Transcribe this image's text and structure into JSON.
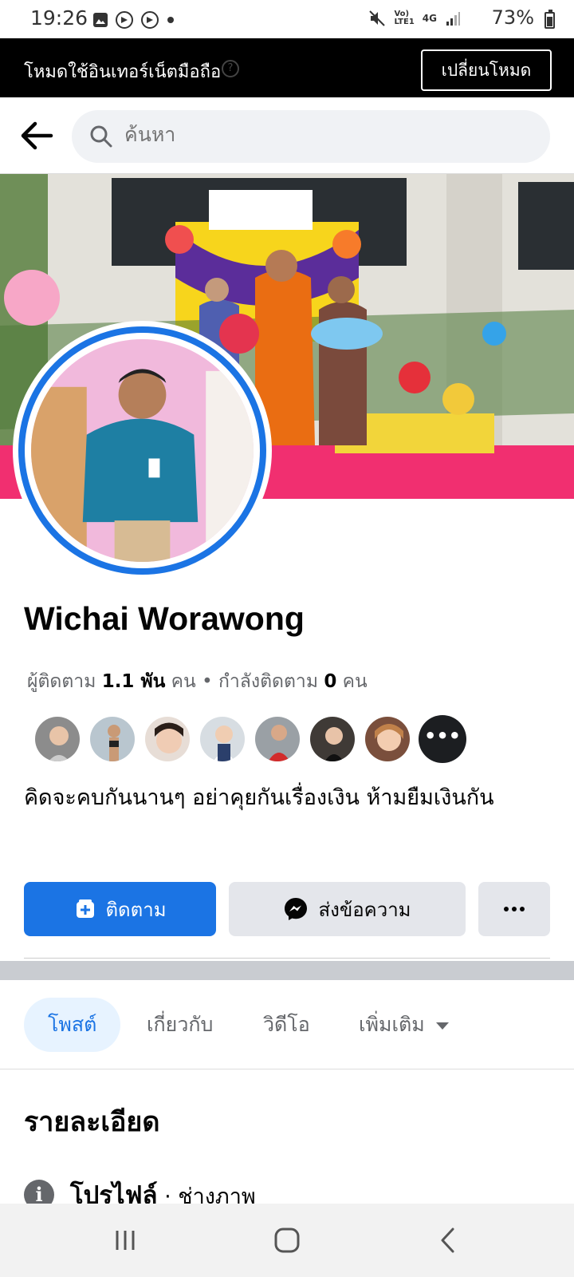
{
  "status_bar": {
    "time": "19:26",
    "battery": "73%",
    "network": "4G"
  },
  "banner": {
    "text": "โหมดใช้อินเทอร์เน็ตมือถือ",
    "button_label": "เปลี่ยนโหมด"
  },
  "search": {
    "placeholder": "ค้นหา"
  },
  "profile": {
    "name": "Wichai Worawong",
    "followers_label": "ผู้ติดตาม",
    "followers_count": "1.1 พัน",
    "followers_unit": "คน",
    "following_label": "กำลังติดตาม",
    "following_count": "0",
    "following_unit": "คน",
    "bio": "คิดจะคบกันนานๆ อย่าคุยกันเรื่องเงิน ห้ามยืมเงินกัน",
    "more_friends": "•••"
  },
  "actions": {
    "follow_label": "ติดตาม",
    "message_label": "ส่งข้อความ"
  },
  "tabs": [
    {
      "label": "โพสต์",
      "active": true
    },
    {
      "label": "เกี่ยวกับ",
      "active": false
    },
    {
      "label": "วิดีโอ",
      "active": false
    },
    {
      "label": "เพิ่มเติม",
      "active": false
    }
  ],
  "details": {
    "title": "รายละเอียด",
    "profile_label": "โปรไฟล์",
    "profile_category": " · ช่างภาพ"
  },
  "colors": {
    "accent": "#1b74e4",
    "banner_bg": "#000000",
    "button_grey": "#e4e6eb"
  }
}
